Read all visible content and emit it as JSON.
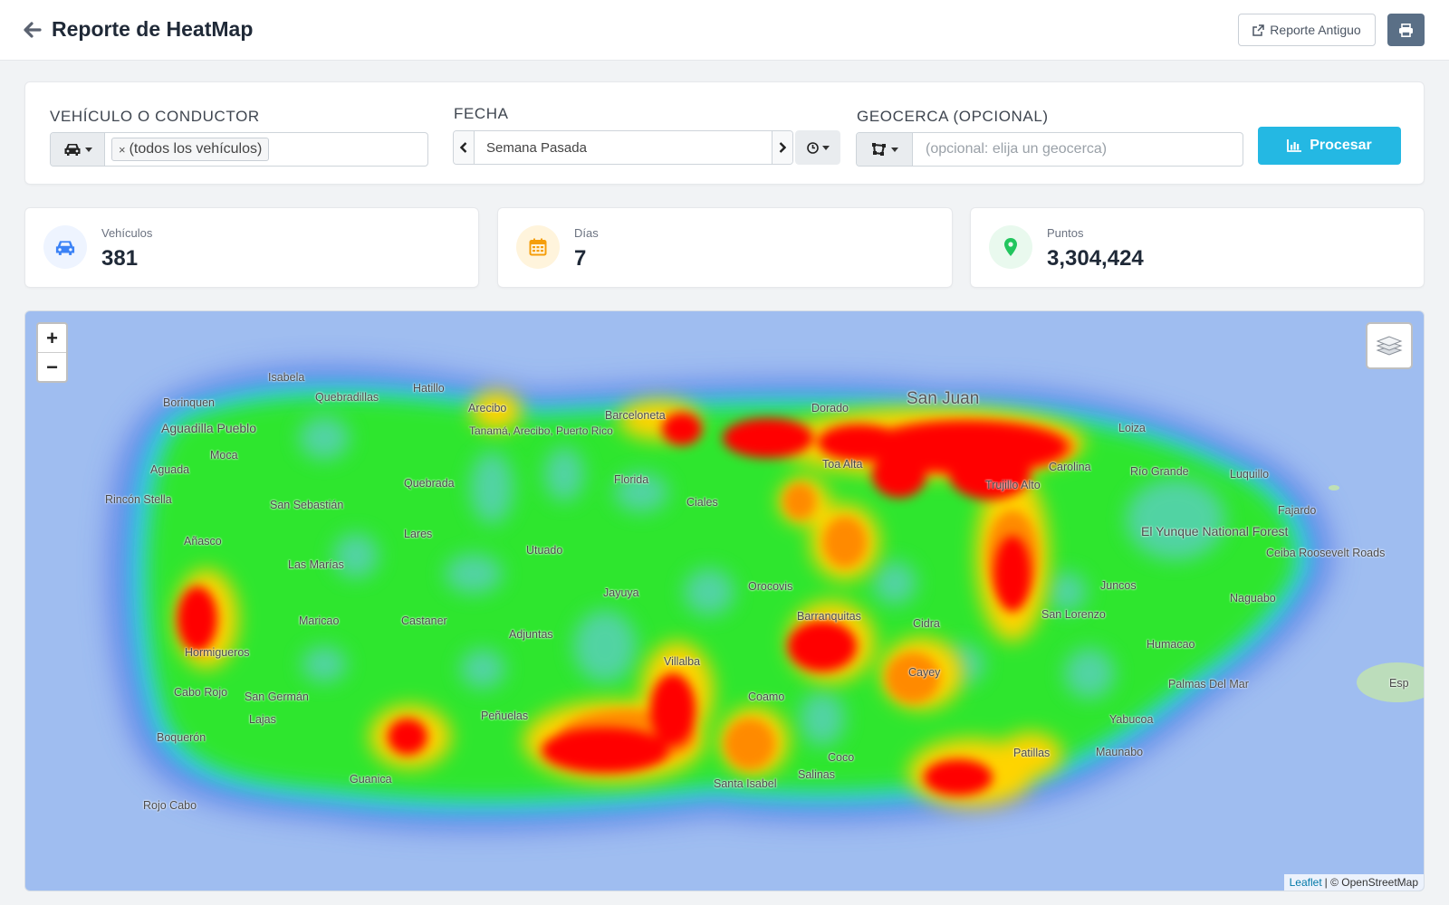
{
  "header": {
    "title": "Reporte de HeatMap",
    "old_report_label": "Reporte Antiguo"
  },
  "filters": {
    "vehicle_label": "VEHÍCULO O CONDUCTOR",
    "vehicle_tag": "(todos los vehículos)",
    "vehicle_tag_remove": "×",
    "date_label": "FECHA",
    "date_value": "Semana Pasada",
    "geofence_label": "GEOCERCA (OPCIONAL)",
    "geofence_placeholder": "(opcional: elija un geocerca)",
    "process_label": "Procesar"
  },
  "stats": [
    {
      "label": "Vehículos",
      "value": "381",
      "icon": "car-icon",
      "color": "#3b82f6",
      "bg": "#eef4ff"
    },
    {
      "label": "Días",
      "value": "7",
      "icon": "calendar-icon",
      "color": "#f59e0b",
      "bg": "#fff4dc"
    },
    {
      "label": "Puntos",
      "value": "3,304,424",
      "icon": "map-marker-icon",
      "color": "#22c55e",
      "bg": "#e9f9ee"
    }
  ],
  "map": {
    "zoom_in": "+",
    "zoom_out": "−",
    "attribution_link": "Leaflet",
    "attribution_text": "| © OpenStreetMap",
    "towns": {
      "isabela": "Isabela",
      "hatillo": "Hatillo",
      "borinquen": "Borinquen",
      "quebradillas": "Quebradillas",
      "aguadilla": "Aguadilla Pueblo",
      "arecibo": "Arecibo",
      "barceloneta": "Barceloneta",
      "dorado": "Dorado",
      "san_juan": "San Juan",
      "loiza": "Loiza",
      "moca": "Moca",
      "aguada": "Aguada",
      "tanama": "Tanamá, Arecibo, Puerto Rico",
      "rio_grande": "Río Grande",
      "luquillo": "Luquillo",
      "quebrada": "Quebrada",
      "florida": "Florida",
      "ciales": "Ciales",
      "rincon": "Rincón Stella",
      "san_sebastian": "San Sebastián",
      "fajardo": "Fajardo",
      "el_yunque": "El Yunque National Forest",
      "lares": "Lares",
      "anasco": "Añasco",
      "utuado": "Utuado",
      "las_marias": "Las Marías",
      "ceiba": "Ceiba Roosevelt Roads",
      "juncos": "Juncos",
      "orocovis": "Orocovis",
      "jayuya": "Jayuya",
      "naguabo": "Naguabo",
      "san_lorenzo": "San Lorenzo",
      "maricao": "Maricao",
      "castaner": "Castaner",
      "cidra": "Cidra",
      "adjuntas": "Adjuntas",
      "hormigueros": "Hormigueros",
      "humacao": "Humacao",
      "villalba": "Villalba",
      "cayey": "Cayey",
      "cabo_rojo": "Cabo Rojo",
      "san_german": "San Germán",
      "palmas": "Palmas Del Mar",
      "coamo": "Coamo",
      "lajas": "Lajas",
      "penuelas": "Peñuelas",
      "yabucoa": "Yabucoa",
      "boqueron": "Boquerón",
      "maunabo": "Maunabo",
      "patillas": "Patillas",
      "coco": "Coco",
      "guanica": "Guanica",
      "santa_isabel": "Santa Isabel",
      "salinas": "Salinas",
      "rojo_cabo": "Rojo Cabo",
      "esp": "Esp",
      "barranquitas": "Barranquitas",
      "toa_alta": "Toa Alta",
      "trujillo": "Trujillo Alto",
      "carolina": "Carolina"
    }
  },
  "colors": {
    "accent": "#24b8e3",
    "print_button": "#5a6f86",
    "heat_hot": "#ff0000",
    "heat_warm": "#ffd000",
    "heat_base": "#2ee62e",
    "sea": "#9fbdf0"
  }
}
